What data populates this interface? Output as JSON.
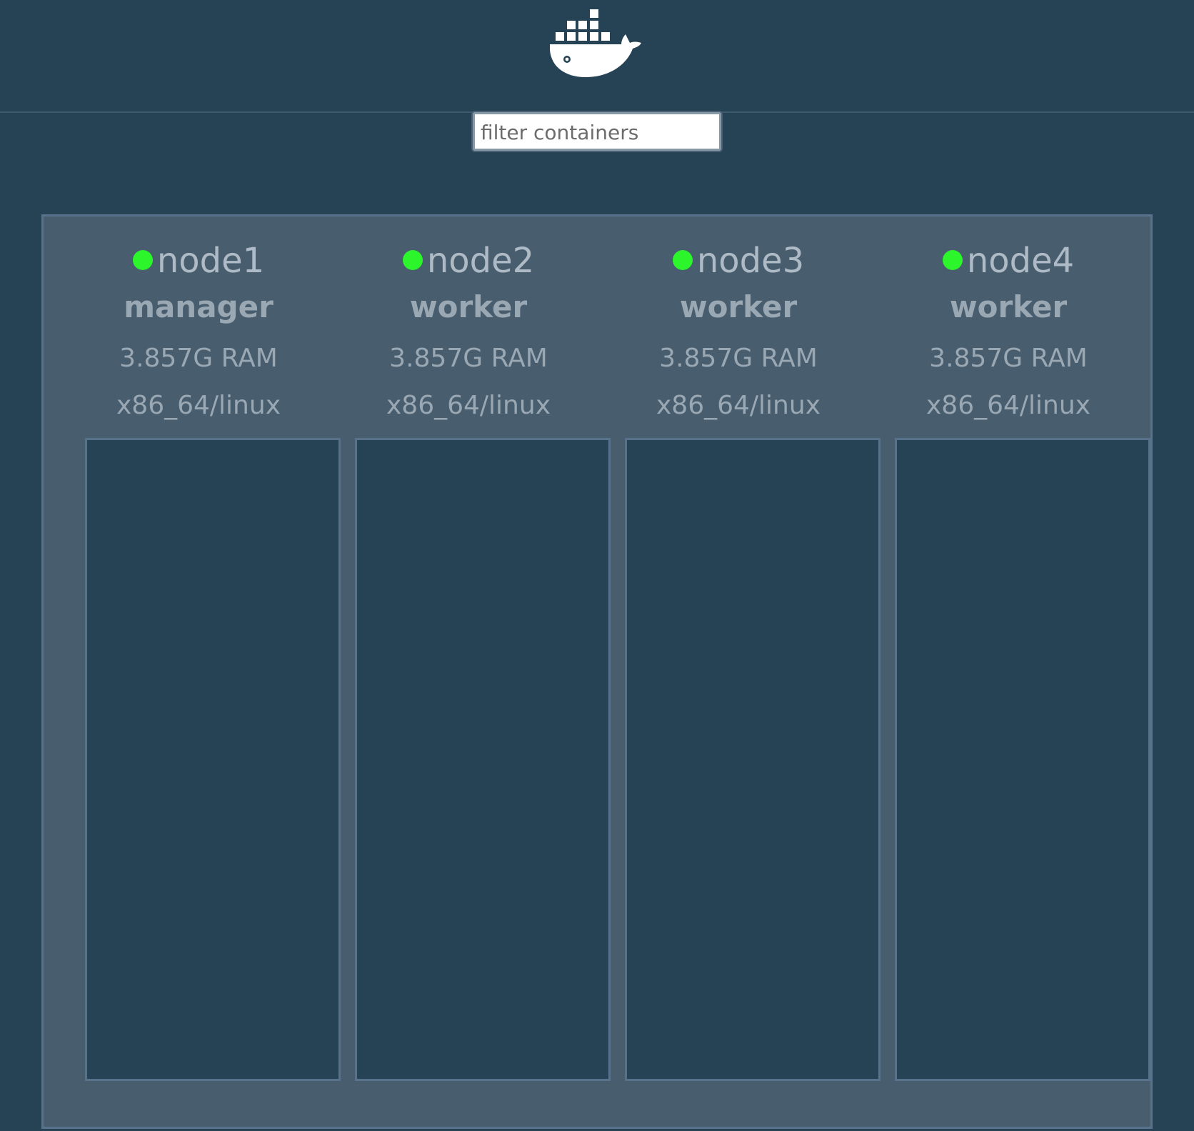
{
  "header": {
    "logo_name": "docker-whale-logo"
  },
  "filter": {
    "placeholder": "filter containers",
    "value": ""
  },
  "colors": {
    "background": "#264356",
    "panel": "#485d6e",
    "status_up": "#2cf52c",
    "text": "#9aa8b4"
  },
  "nodes": [
    {
      "name": "node1",
      "role": "manager",
      "ram": "3.857G RAM",
      "arch": "x86_64/linux",
      "status": "ready"
    },
    {
      "name": "node2",
      "role": "worker",
      "ram": "3.857G RAM",
      "arch": "x86_64/linux",
      "status": "ready"
    },
    {
      "name": "node3",
      "role": "worker",
      "ram": "3.857G RAM",
      "arch": "x86_64/linux",
      "status": "ready"
    },
    {
      "name": "node4",
      "role": "worker",
      "ram": "3.857G RAM",
      "arch": "x86_64/linux",
      "status": "ready"
    }
  ]
}
